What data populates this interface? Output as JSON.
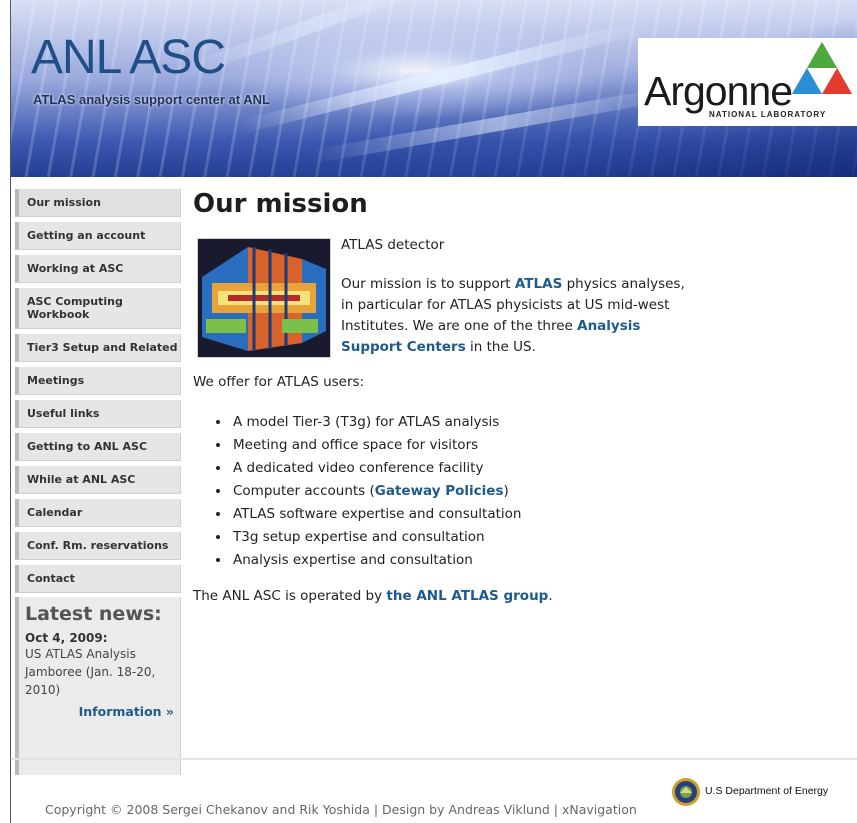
{
  "header": {
    "title": "ANL ASC",
    "subtitle": "ATLAS analysis support center at ANL",
    "logo": {
      "word": "Argonne",
      "sub": "NATIONAL LABORATORY"
    }
  },
  "sidebar": {
    "items": [
      {
        "label": "Our mission"
      },
      {
        "label": "Getting an account"
      },
      {
        "label": "Working at ASC"
      },
      {
        "label": "ASC Computing Workbook"
      },
      {
        "label": "Tier3 Setup and Related"
      },
      {
        "label": "Meetings"
      },
      {
        "label": "Useful links"
      },
      {
        "label": "Getting to ANL ASC"
      },
      {
        "label": "While at ANL ASC"
      },
      {
        "label": "Calendar"
      },
      {
        "label": "Conf. Rm. reservations"
      },
      {
        "label": "Contact"
      }
    ],
    "news": {
      "title": "Latest news:",
      "date": "Oct 4, 2009:",
      "text": "US ATLAS Analysis Jamboree (Jan. 18-20, 2010)",
      "link": "Information »"
    }
  },
  "main": {
    "title": "Our mission",
    "caption": "ATLAS detector",
    "mission": {
      "p1": "Our mission is to support ",
      "link1": "ATLAS",
      "p2": " physics analyses, in particular for ATLAS physicists at US mid-west Institutes. We are one of the three ",
      "link2": "Analysis Support Centers",
      "p3": " in the US."
    },
    "offer_lead": "We offer for ATLAS users:",
    "offers": [
      "A model Tier-3 (T3g) for ATLAS analysis",
      "Meeting and office space for visitors",
      "A dedicated video conference facility",
      "Computer accounts (",
      "ATLAS software expertise and consultation",
      "T3g setup expertise and consultation",
      "Analysis expertise and consultation"
    ],
    "offer_link": "Gateway Policies",
    "offer_link_close": ")",
    "operated": {
      "pre": "The ANL ASC is operated by ",
      "link": "the ANL ATLAS group",
      "post": "."
    }
  },
  "footer": {
    "doe": "U.S Department of Energy",
    "copyright": "Copyright © 2008 Sergei Chekanov and Rik Yoshida | Design by Andreas Viklund | xNavigation"
  }
}
